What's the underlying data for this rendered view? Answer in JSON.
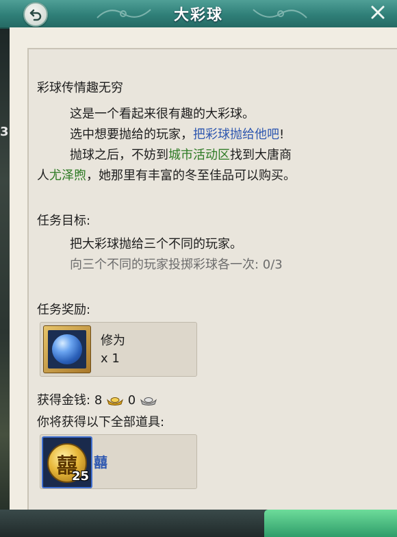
{
  "header": {
    "title": "大彩球"
  },
  "edge": {
    "number": "3"
  },
  "description": {
    "heading": "彩球传情趣无穷",
    "line1": "这是一个看起来很有趣的大彩球。",
    "line2_prefix": "选中想要抛给的玩家，",
    "line2_highlight": "把彩球抛给他吧",
    "line2_suffix": "!",
    "line3_prefix": "抛球之后，不妨到",
    "line3_highlight": "城市活动区",
    "line3_suffix": "找到大唐商",
    "line4_prefix": "人",
    "line4_highlight": "尤泽煦",
    "line4_suffix": "，她那里有丰富的冬至佳品可以购买。"
  },
  "objective": {
    "heading": "任务目标:",
    "task": "把大彩球抛给三个不同的玩家。",
    "progress": "向三个不同的玩家投掷彩球各一次: 0/3"
  },
  "rewards": {
    "heading": "任务奖励:",
    "item_name": "修为",
    "item_qty": "x 1"
  },
  "money": {
    "label": "获得金钱:",
    "gold": "8",
    "silver": "0"
  },
  "items": {
    "heading": "你将获得以下全部道具:",
    "coin_char": "囍",
    "coin_qty": "25",
    "side_char": "囍"
  },
  "colors": {
    "header": "#2f7f78",
    "panel": "#e9e5dc",
    "highlight_blue": "#2f58b0",
    "highlight_green": "#2d7a24"
  }
}
